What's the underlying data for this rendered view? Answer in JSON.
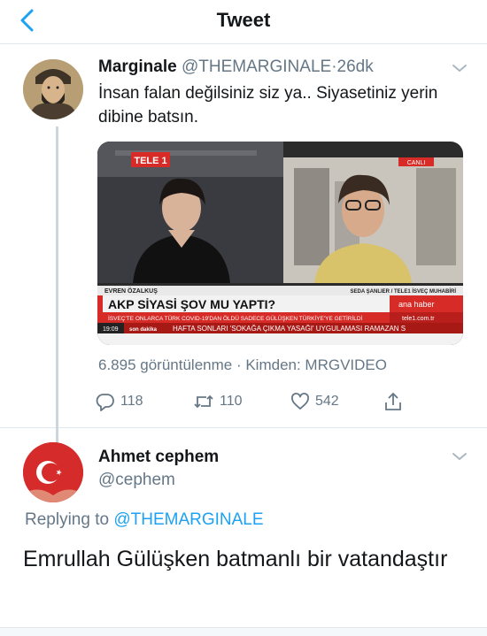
{
  "header": {
    "title": "Tweet"
  },
  "colors": {
    "accent": "#1da1f2",
    "secondary_text": "#657786",
    "primary_text": "#14171a"
  },
  "tweet": {
    "name": "Marginale",
    "handle": "@THEMARGINALE",
    "separator": "·",
    "time": "26dk",
    "text": "İnsan falan değilsiniz siz ya.. Siyasetiniz yerin dibine batsın.",
    "media": {
      "channel_logo": "TELE 1",
      "live_badge": "CANLI",
      "left_name": "EVREN ÖZALKUŞ",
      "right_name": "SEDA ŞANLIER / TELE1 İSVEÇ MUHABİRİ",
      "headline": "AKP SİYASİ ŞOV MU YAPTI?",
      "program": "ana haber",
      "subline": "İSVEÇ'TE ONLARCA TÜRK COVID-19'DAN ÖLDÜ SADECE GÜLÜŞKEN TÜRKİYE'YE GETİRİLDİ",
      "site": "tele1.com.tr",
      "clock": "19:09",
      "ticker_label": "son dakika",
      "ticker_text": "HAFTA SONLARI 'SOKAĞA ÇIKMA YASAĞI' UYGULAMASI RAMAZAN S"
    },
    "views": "6.895 görüntülenme · Kimden: MRGVIDEO",
    "replies": "118",
    "retweets": "110",
    "likes": "542"
  },
  "reply": {
    "name": "Ahmet cephem",
    "handle": "@cephem",
    "replying_prefix": "Replying to ",
    "replying_to": "@THEMARGINALE",
    "text": "Emrullah Gülüşken batmanlı bir vatandaştır"
  }
}
